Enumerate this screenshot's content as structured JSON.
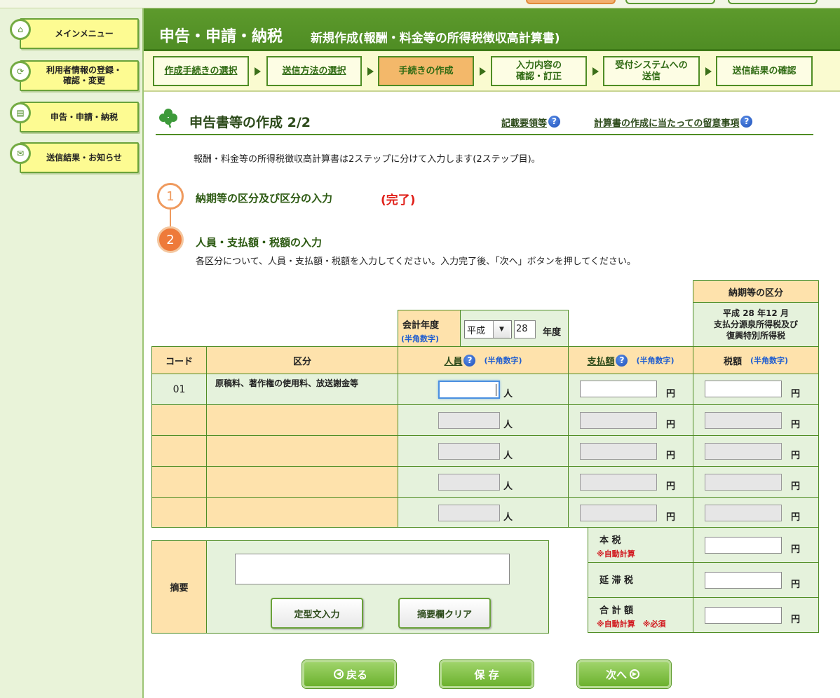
{
  "sidebar": {
    "items": [
      {
        "label": "メインメニュー",
        "icon": "home-icon"
      },
      {
        "label": "利用者情報の登録・\n確認・変更",
        "icon": "refresh-icon"
      },
      {
        "label": "申告・申請・納税",
        "icon": "document-icon"
      },
      {
        "label": "送信結果・お知らせ",
        "icon": "mail-icon"
      }
    ]
  },
  "header": {
    "title": "申告・申請・納税",
    "subtitle": "新規作成(報酬・料金等の所得税徴収高計算書)"
  },
  "steps": [
    {
      "label": "作成手続きの選択"
    },
    {
      "label": "送信方法の選択"
    },
    {
      "label": "手続きの作成"
    },
    {
      "label": "入力内容の\n確認・訂正"
    },
    {
      "label": "受付システムへの\n送信"
    },
    {
      "label": "送信結果の確認"
    }
  ],
  "page": {
    "title": "申告書等の作成 2/2",
    "link_guide": "記載要領等",
    "link_notes": "計算書の作成に当たっての留意事項",
    "intro": "報酬・料金等の所得税徴収高計算書は2ステップに分けて入力します(2ステップ目)。",
    "step1": {
      "num": "1",
      "label": "納期等の区分及び区分の入力",
      "status": "(完了)"
    },
    "step2": {
      "num": "2",
      "label": "人員・支払額・税額の入力",
      "desc": "各区分について、人員・支払額・税額を入力してください。入力完了後、「次へ」ボタンを押してください。"
    }
  },
  "form": {
    "period_header": "納期等の区分",
    "period_value": "平成 28 年12 月\n支払分源泉所得税及び\n復興特別所得税",
    "fiscal_year_label": "会計年度",
    "fiscal_year_note": "(半角数字)",
    "era_value": "平成",
    "year_value": "28",
    "year_suffix": "年度",
    "col_code": "コード",
    "col_category": "区分",
    "col_persons": "人員",
    "col_payment": "支払額",
    "col_tax": "税額",
    "halfwidth_note": "(半角数字)",
    "unit_person": "人",
    "unit_yen": "円",
    "row1_code": "01",
    "row1_category": "原稿料、著作権の使用料、放送謝金等",
    "main_tax_label": "本 税",
    "auto_calc_note": "※自動計算",
    "late_tax_label": "延 滞 税",
    "total_label": "合 計 額",
    "total_note": "※自動計算　※必須",
    "summary_label": "摘要",
    "template_button": "定型文入力",
    "clear_button": "摘要欄クリア"
  },
  "nav": {
    "back": "戻る",
    "save": "保 存",
    "next": "次へ"
  },
  "colors": {
    "header_green": "#5d9a2c",
    "peach": "#fee2ac",
    "mint": "#e5f2dc",
    "active_step": "#f3b86a",
    "done_red": "#e0201a"
  }
}
